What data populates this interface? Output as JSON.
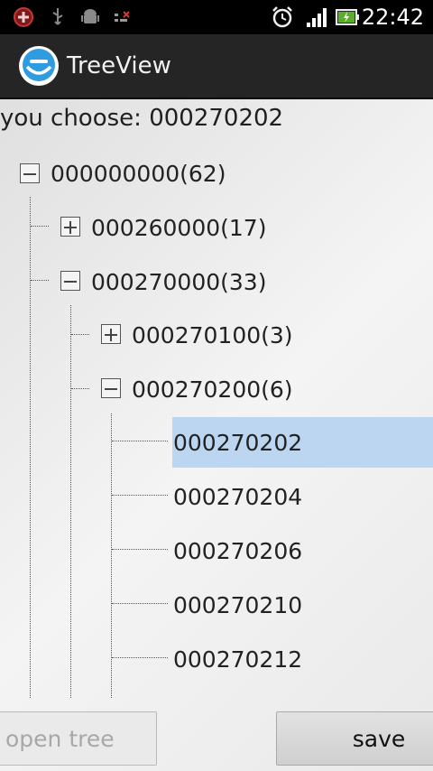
{
  "status_bar": {
    "time": "22:42",
    "left_icons": [
      "stop-icon",
      "usb-icon",
      "android-debug-icon",
      "sim-icon"
    ],
    "right_icons": [
      "alarm-icon",
      "signal-icon",
      "battery-charging-icon"
    ]
  },
  "action_bar": {
    "title": "TreeView",
    "icon": "app-face-icon"
  },
  "selection": {
    "label": "you choose: 000270202"
  },
  "tree": {
    "root": {
      "label": "000000000(62)",
      "expanded": true
    },
    "level1": [
      {
        "label": "000260000(17)",
        "expanded": false
      },
      {
        "label": "000270000(33)",
        "expanded": true
      }
    ],
    "level2": [
      {
        "label": "000270100(3)",
        "expanded": false
      },
      {
        "label": "000270200(6)",
        "expanded": true
      }
    ],
    "leaves": [
      {
        "label": "000270202",
        "selected": true
      },
      {
        "label": "000270204",
        "selected": false
      },
      {
        "label": "000270206",
        "selected": false
      },
      {
        "label": "000270210",
        "selected": false
      },
      {
        "label": "000270212",
        "selected": false
      }
    ],
    "selected_color": "#bcd6f2"
  },
  "buttons": {
    "open_tree": "open tree",
    "save": "save"
  }
}
